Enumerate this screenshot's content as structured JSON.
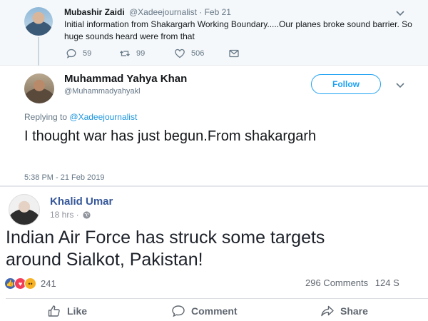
{
  "tweet1": {
    "name": "Mubashir Zaidi",
    "handle_date": "@Xadeejournalist · Feb 21",
    "body": "Initial information from Shakargarh Working Boundary.....Our planes broke sound barrier. So huge sounds heard were from that",
    "replies": "59",
    "retweets": "99",
    "likes": "506"
  },
  "tweet2": {
    "name": "Muhammad Yahya Khan",
    "handle": "@Muhammadyahyakl",
    "follow_label": "Follow",
    "replying_prefix": "Replying to",
    "replying_handle": "@Xadeejournalist",
    "body": "I thought war has just begun.From shakargarh",
    "timestamp": "5:38 PM - 21 Feb 2019"
  },
  "fb_post": {
    "name": "Khalid Umar",
    "time": "18 hrs ·",
    "body_line1": "Indian Air Force has struck some targets",
    "body_line2": "around Sialkot, Pakistan!",
    "reaction_count": "241",
    "comments": "296 Comments",
    "shares": "124 S",
    "like_label": "Like",
    "comment_label": "Comment",
    "share_label": "Share"
  },
  "colors": {
    "twitter_blue": "#1da1f2",
    "fb_blue": "#365899",
    "muted": "#657786"
  },
  "icons": [
    "reply-icon",
    "retweet-icon",
    "heart-icon",
    "dm-icon",
    "chevron-down-icon",
    "globe-icon",
    "like-icon",
    "comment-icon",
    "share-icon"
  ]
}
